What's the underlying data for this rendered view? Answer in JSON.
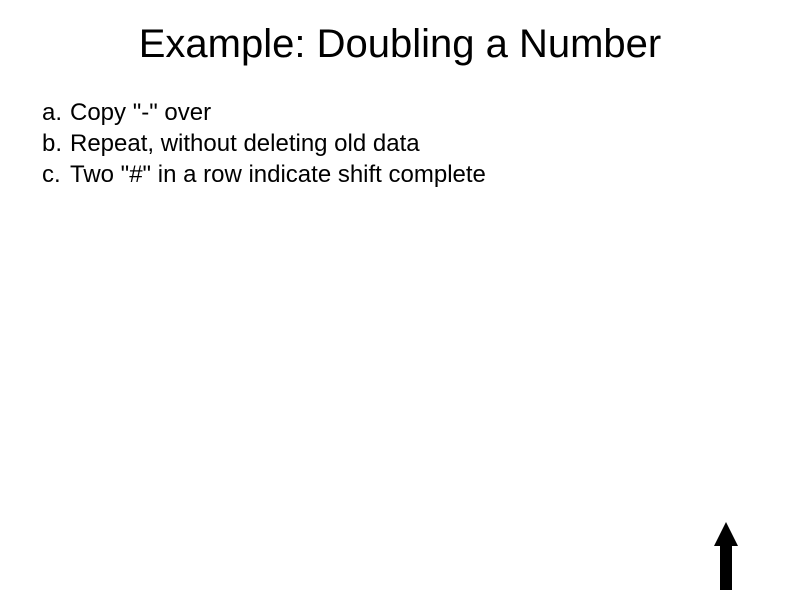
{
  "title": "Example: Doubling a Number",
  "items": [
    {
      "prefix": "a.",
      "text": "Copy \"-\" over"
    },
    {
      "prefix": "b.",
      "text": "Repeat, without deleting old data"
    },
    {
      "prefix": "c.",
      "text": "Two \"#\" in a row indicate shift complete"
    }
  ]
}
